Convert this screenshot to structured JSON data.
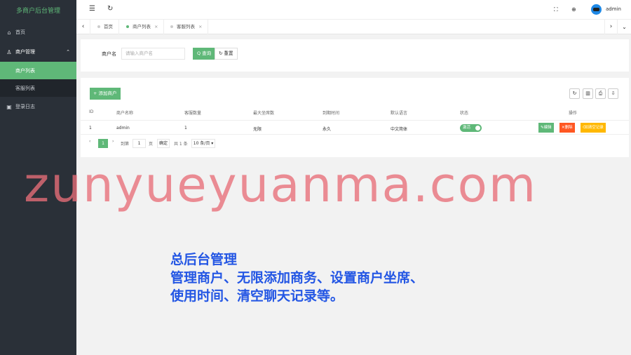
{
  "sidebar": {
    "brand": "多商户后台管理",
    "items": [
      {
        "label": "首页"
      },
      {
        "label": "商户管理",
        "children": [
          {
            "label": "商户列表"
          },
          {
            "label": "客服列表"
          }
        ]
      },
      {
        "label": "登录日志"
      }
    ]
  },
  "topbar": {
    "username": "admin"
  },
  "tabs": [
    {
      "label": "首页"
    },
    {
      "label": "商户列表"
    },
    {
      "label": "客服列表"
    }
  ],
  "search": {
    "label": "商户名",
    "placeholder": "请输入商户名",
    "search_btn": "Q 查询",
    "reset_btn": "重置"
  },
  "table": {
    "add_btn": "+ 添加商户",
    "columns": [
      "ID",
      "商户名称",
      "客服数量",
      "最大坐席数",
      "到期时间",
      "默认语言",
      "状态",
      "操作"
    ],
    "rows": [
      {
        "id": "1",
        "name": "admin",
        "service_count": "1",
        "max_seats": "无限",
        "expire": "永久",
        "lang": "中文简体",
        "status": "激活",
        "actions": {
          "edit": "编辑",
          "delete": "删除",
          "clear": "清空记录"
        }
      }
    ],
    "pager": {
      "current": "1",
      "goto_label": "到第",
      "goto_value": "1",
      "page_unit": "页",
      "confirm": "确定",
      "total": "共 1 条",
      "per_page": "10 条/页 ▾"
    }
  },
  "overlay": {
    "watermark": "zunyueyuanma.com",
    "caption_line1": "总后台管理",
    "caption_line2": "管理商户、无限添加商务、设置商户坐席、",
    "caption_line3": "使用时间、清空聊天记录等。"
  },
  "colors": {
    "accent": "#5fb878",
    "sidebar": "#2a3038",
    "danger": "#ff5722",
    "warn": "#ffb800",
    "caption": "#2356e4"
  }
}
